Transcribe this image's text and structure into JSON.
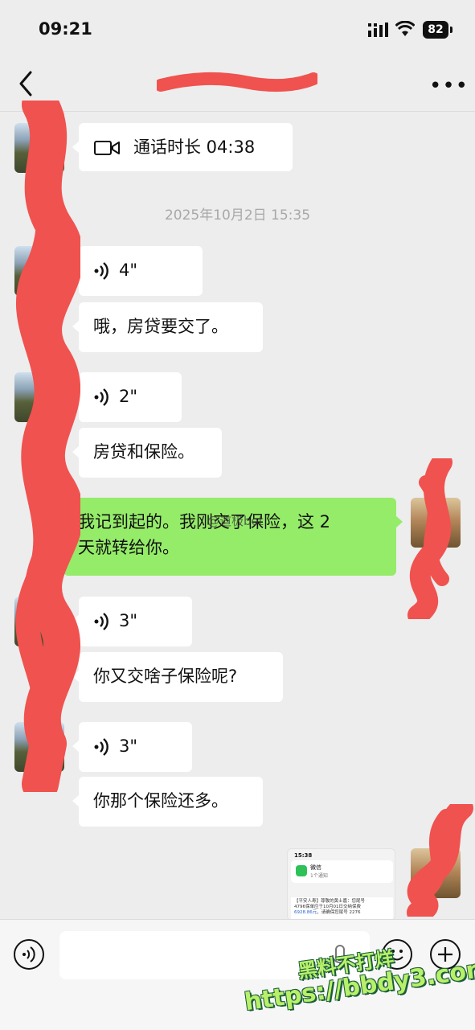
{
  "status_bar": {
    "time": "09:21",
    "battery": "82"
  },
  "nav": {
    "title": ""
  },
  "call": {
    "label": "通话时长 04:38"
  },
  "timestamp": "2025年10月2日 15:35",
  "messages": [
    {
      "id": "v1",
      "type": "voice",
      "text": "4\""
    },
    {
      "id": "t1",
      "type": "text",
      "text": "哦，房贷要交了。"
    },
    {
      "id": "v2",
      "type": "voice",
      "text": "2\""
    },
    {
      "id": "t2",
      "type": "text",
      "text": "房贷和保险。"
    },
    {
      "id": "me1",
      "type": "text",
      "sender": "me",
      "line1": "我记到起的。我刚交了保险，这 2",
      "line2": "天就转给你。"
    },
    {
      "id": "v3",
      "type": "voice",
      "text": "3\""
    },
    {
      "id": "t3",
      "type": "text",
      "text": "你又交啥子保险呢?"
    },
    {
      "id": "v4",
      "type": "voice",
      "text": "3\""
    },
    {
      "id": "t4",
      "type": "text",
      "text": "你那个保险还多。"
    }
  ],
  "image_message": {
    "time": "15:38",
    "app_name": "微信",
    "app_sub": "1个通知",
    "sms_line1": "【平安人寿】尊敬的黄士嘉：您尾号",
    "sms_line2": "4796保单应于10月01日交纳保费",
    "sms_amount": "6928.86元",
    "sms_line3": "，请确保您尾号 2276"
  },
  "watermarks": {
    "weibo": "@道极bot",
    "brand_line1": "黑料不打烊",
    "brand_line2": "https://bbdy3.com"
  },
  "colors": {
    "background": "#ededed",
    "me_bubble": "#95ec69",
    "scribble": "#f0524f"
  }
}
